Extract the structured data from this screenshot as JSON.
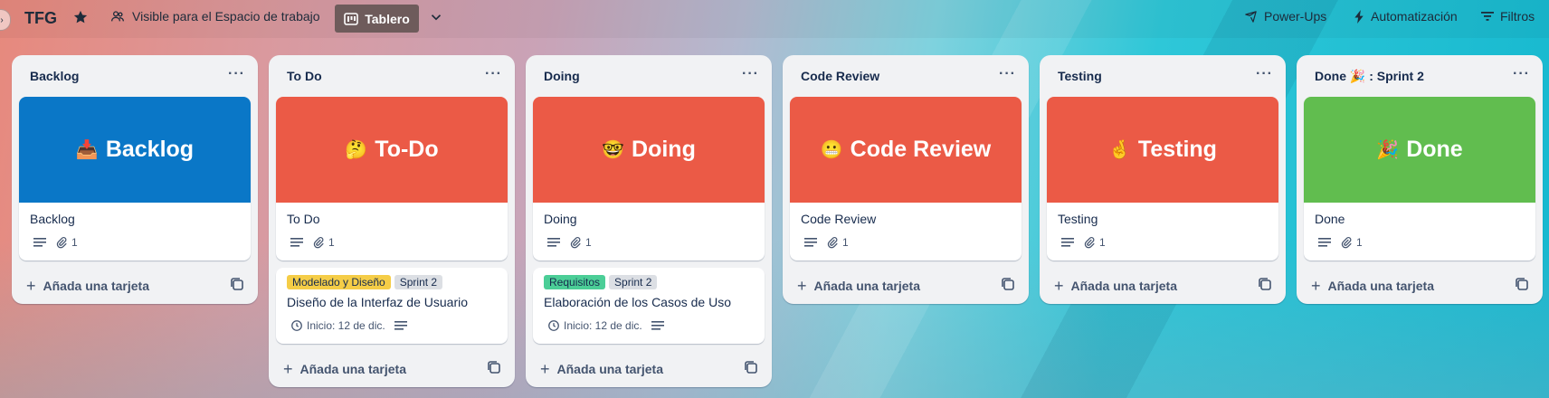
{
  "header": {
    "board_title": "TFG",
    "visibility_label": "Visible para el Espacio de trabajo",
    "view_label": "Tablero",
    "powerups_label": "Power-Ups",
    "automation_label": "Automatización",
    "filters_label": "Filtros"
  },
  "add_card_label": "Añada una tarjeta",
  "colors": {
    "blue_cover": "#0a77c7",
    "red_cover": "#eb5a46",
    "green_cover": "#61bd4f",
    "label_yellow": "#f5cd47",
    "label_gray": "#dcdfe4",
    "label_green": "#4bce97"
  },
  "lists": [
    {
      "title": "Backlog",
      "cover_card": {
        "cover_emoji": "📥",
        "cover_text": "Backlog",
        "title": "Backlog",
        "attachments": "1"
      }
    },
    {
      "title": "To Do",
      "cover_card": {
        "cover_emoji": "🤔",
        "cover_text": "To-Do",
        "title": "To Do",
        "attachments": "1"
      },
      "task_card": {
        "labels": [
          "Modelado y Diseño",
          "Sprint 2"
        ],
        "title": "Diseño de la Interfaz de Usuario",
        "start": "Inicio: 12 de dic."
      }
    },
    {
      "title": "Doing",
      "cover_card": {
        "cover_emoji": "🤓",
        "cover_text": "Doing",
        "title": "Doing",
        "attachments": "1"
      },
      "task_card": {
        "labels": [
          "Requisitos",
          "Sprint 2"
        ],
        "title": "Elaboración de los Casos de Uso",
        "start": "Inicio: 12 de dic."
      }
    },
    {
      "title": "Code Review",
      "cover_card": {
        "cover_emoji": "😬",
        "cover_text": "Code Review",
        "title": "Code Review",
        "attachments": "1"
      }
    },
    {
      "title": "Testing",
      "cover_card": {
        "cover_emoji": "🤞",
        "cover_text": "Testing",
        "title": "Testing",
        "attachments": "1"
      }
    },
    {
      "title": "Done 🎉 : Sprint 2",
      "cover_card": {
        "cover_emoji": "🎉",
        "cover_text": "Done",
        "title": "Done",
        "attachments": "1"
      }
    }
  ]
}
